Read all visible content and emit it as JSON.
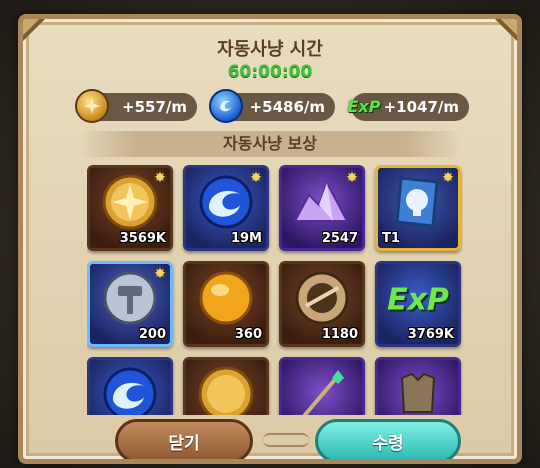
{
  "panel": {
    "title": "자동사냥 시간",
    "timer": "60:00:00",
    "section_title": "자동사냥 보상"
  },
  "rates": [
    {
      "icon": "gold-coin-icon",
      "value": "+557/m"
    },
    {
      "icon": "blue-gem-icon",
      "value": "+5486/m"
    },
    {
      "icon": "exp-icon",
      "label": "ExP",
      "value": "+1047/m"
    }
  ],
  "items": [
    {
      "name": "gold-coin-item",
      "qty": "3569K",
      "frame": "brown",
      "badge": "✸"
    },
    {
      "name": "blue-orb-item",
      "qty": "19M",
      "frame": "blue",
      "badge": "✸"
    },
    {
      "name": "purple-crystal-item",
      "qty": "2547",
      "frame": "purple",
      "badge": "✸"
    },
    {
      "name": "tier-scroll-item",
      "qty": "T1",
      "frame": "gold-frame",
      "badge": "✸"
    },
    {
      "name": "hammer-token-item",
      "qty": "200",
      "frame": "lightblue",
      "badge": "✸"
    },
    {
      "name": "gold-orb-item",
      "qty": "360",
      "frame": "brown",
      "badge": ""
    },
    {
      "name": "bronze-medallion-item",
      "qty": "1180",
      "frame": "brown",
      "badge": ""
    },
    {
      "name": "exp-item",
      "qty": "3769K",
      "frame": "blue",
      "badge": "",
      "label": "ExP"
    },
    {
      "name": "blue-orb-item-2",
      "qty": "",
      "frame": "blue",
      "badge": ""
    },
    {
      "name": "gold-coin-item-2",
      "qty": "",
      "frame": "brown",
      "badge": ""
    },
    {
      "name": "green-staff-item",
      "qty": "",
      "frame": "purple",
      "badge": ""
    },
    {
      "name": "armor-item",
      "qty": "",
      "frame": "purple",
      "badge": ""
    }
  ],
  "buttons": {
    "close_label": "닫기",
    "claim_label": "수령"
  },
  "colors": {
    "timer": "#3fbf3a",
    "title": "#5a3f24",
    "claim_button": "#2fb9b2",
    "close_button": "#8f5a33"
  }
}
